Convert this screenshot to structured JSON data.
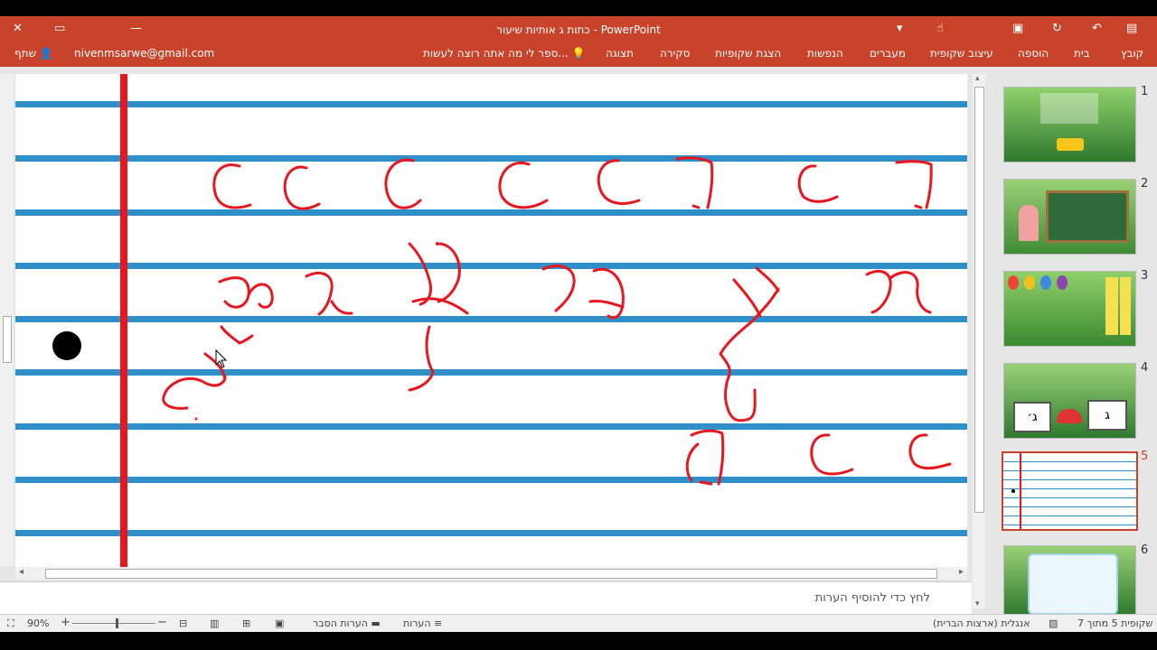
{
  "window": {
    "title": "כתות ג אותיות  שיעור - PowerPoint"
  },
  "ribbon": {
    "tabs": [
      "קובץ",
      "בית",
      "הוספה",
      "עיצוב שקופית",
      "מעברים",
      "הנפשות",
      "הצגת שקופיות",
      "סקירה",
      "תצוגה"
    ],
    "tell_me": "ספר לי מה אתה רוצה לעשות...",
    "user_email": "nivenmsarwe@gmail.com",
    "share_label": "שתף"
  },
  "notes": {
    "placeholder": "לחץ כדי להוסיף הערות"
  },
  "thumbnails": {
    "numbers": [
      "1",
      "2",
      "3",
      "4",
      "5",
      "6"
    ],
    "active_index": 5,
    "slide4_letters": [
      "ג",
      "ג׳"
    ]
  },
  "status_bar": {
    "slide_info": "שקופית 5 מתוך 7",
    "language": "אנגלית (ארצות הברית)",
    "notes_label": "הערות",
    "comments_label": "הערות הסבר",
    "zoom": "90%"
  },
  "colors": {
    "accent": "#c9432a",
    "ink": "#e8161f",
    "ruled_line": "#2f8fc9"
  }
}
